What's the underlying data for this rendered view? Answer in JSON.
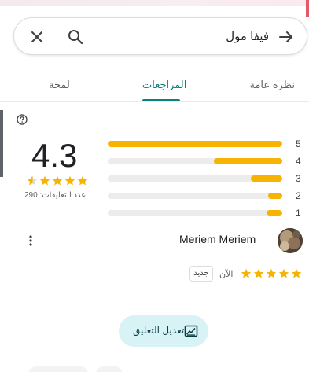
{
  "search": {
    "query": "فيفا مول",
    "close_icon": "close-icon",
    "search_icon": "search-icon",
    "directions_icon": "arrow-right-icon"
  },
  "tabs": [
    {
      "label": "نظرة عامة",
      "selected": false
    },
    {
      "label": "المراجعات",
      "selected": true
    },
    {
      "label": "لمحة",
      "selected": false
    }
  ],
  "summary": {
    "rating": "4.3",
    "rating_value": 4.3,
    "reviews_count_text": "عدد التعليقات: 290",
    "histogram": [
      {
        "stars": "5",
        "fraction": 1.0
      },
      {
        "stars": "4",
        "fraction": 0.39
      },
      {
        "stars": "3",
        "fraction": 0.18
      },
      {
        "stars": "2",
        "fraction": 0.08
      },
      {
        "stars": "1",
        "fraction": 0.09
      }
    ]
  },
  "review": {
    "author": "Meriem Meriem",
    "stars": 5,
    "time": "الآن",
    "badge": "جديد"
  },
  "actions": {
    "edit_review": "تعديل التعليق"
  },
  "colors": {
    "accent": "#0b7f7a",
    "star": "#f6b400",
    "edit_button_bg": "#d8f3f6"
  }
}
